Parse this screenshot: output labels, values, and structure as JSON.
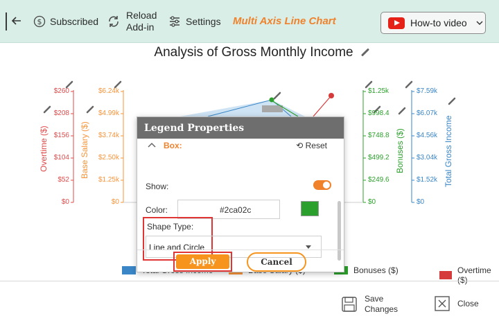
{
  "toolbar": {
    "subscribed_label": "Subscribed",
    "reload_label_1": "Reload",
    "reload_label_2": "Add-in",
    "settings_label": "Settings",
    "chart_title": "Multi Axis Line Chart",
    "howto_label": "How-to video"
  },
  "chart": {
    "title": "Analysis of Gross Monthly Income",
    "axes": {
      "overtime": {
        "label": "Overtime ($)",
        "ticks": [
          "$260",
          "$208",
          "$156",
          "$104",
          "$52",
          "$0"
        ],
        "color": "#e04a4a"
      },
      "base_salary": {
        "label": "Base Salary ($)",
        "ticks": [
          "$6.24k",
          "$4.99k",
          "$3.74k",
          "$2.50k",
          "$1.25k",
          "$0"
        ],
        "color": "#f7943a"
      },
      "bonuses": {
        "label": "Bonuses ($)",
        "ticks": [
          "$1.25k",
          "$998.4",
          "$748.8",
          "$499.2",
          "$249.6",
          "$0"
        ],
        "color": "#2ca02c"
      },
      "total_gross": {
        "label": "Total Gross Income",
        "ticks": [
          "$7.59k",
          "$6.07k",
          "$4.56k",
          "$3.04k",
          "$1.52k",
          "$0"
        ],
        "color": "#3a86c6"
      }
    },
    "legend": [
      {
        "label": "Total Gross Income",
        "color": "#3a86c6"
      },
      {
        "label": "Base Salary ($)",
        "color": "#f7943a"
      },
      {
        "label": "Bonuses ($)",
        "color": "#2ca02c"
      },
      {
        "label": "Overtime ($)",
        "color": "#d63b3b"
      }
    ]
  },
  "modal": {
    "title": "Legend Properties",
    "box_label": "Box:",
    "reset_label": "Reset",
    "show_label": "Show:",
    "show_value": true,
    "color_label": "Color:",
    "color_value": "#2ca02c",
    "shape_type_label": "Shape Type:",
    "shape_type_value": "Line and Circle",
    "apply_label": "Apply",
    "cancel_label": "Cancel"
  },
  "footer": {
    "save_label_1": "Save",
    "save_label_2": "Changes",
    "close_label": "Close"
  }
}
